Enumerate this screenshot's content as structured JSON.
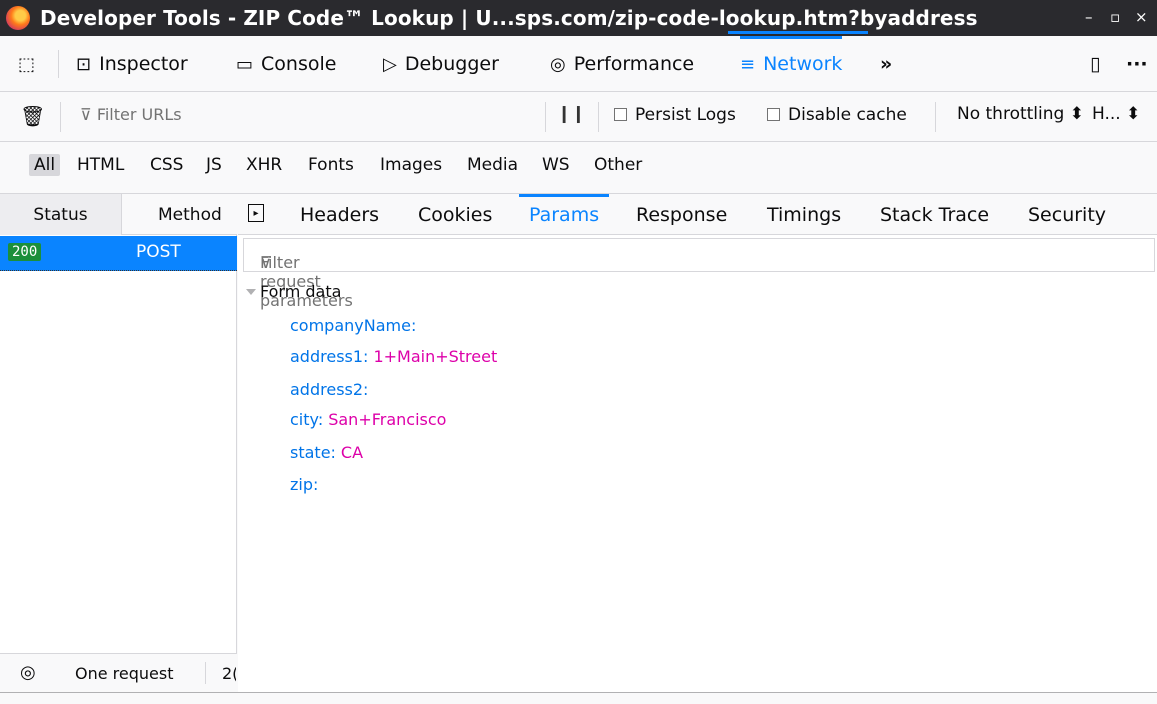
{
  "window": {
    "title": "Developer Tools - ZIP Code™ Lookup | U...sps.com/zip-code-lookup.htm?byaddress",
    "controls": [
      "–",
      "▫",
      "×"
    ]
  },
  "toolbar": {
    "tabs": [
      {
        "label": "Inspector",
        "icon": "inspector-icon"
      },
      {
        "label": "Console",
        "icon": "console-icon"
      },
      {
        "label": "Debugger",
        "icon": "debugger-icon"
      },
      {
        "label": "Performance",
        "icon": "performance-icon"
      },
      {
        "label": "Network",
        "icon": "network-icon",
        "active": true
      }
    ],
    "overflow": "»",
    "more": "···"
  },
  "filterbar": {
    "filter_placeholder": "Filter URLs",
    "pause": "❙❙",
    "persist_logs": "Persist Logs",
    "disable_cache": "Disable cache",
    "throttling": "No throttling ⬍",
    "har": "H... ⬍"
  },
  "type_filters": [
    "All",
    "HTML",
    "CSS",
    "JS",
    "XHR",
    "Fonts",
    "Images",
    "Media",
    "WS",
    "Other"
  ],
  "request_list": {
    "columns": {
      "status": "Status",
      "method": "Method"
    },
    "rows": [
      {
        "status": "200",
        "method": "POST"
      }
    ],
    "footer": {
      "count": "One request",
      "size": "2("
    }
  },
  "details": {
    "tabs": [
      "Headers",
      "Cookies",
      "Params",
      "Response",
      "Timings",
      "Stack Trace",
      "Security"
    ],
    "active_tab": "Params",
    "param_filter_placeholder": "Filter request parameters",
    "section": "Form data",
    "params": [
      {
        "key": "companyName:",
        "value": ""
      },
      {
        "key": "address1:",
        "value": "1+Main+Street"
      },
      {
        "key": "address2:",
        "value": ""
      },
      {
        "key": "city:",
        "value": "San+Francisco"
      },
      {
        "key": "state:",
        "value": "CA"
      },
      {
        "key": "zip:",
        "value": ""
      }
    ]
  },
  "colors": {
    "accent": "#0a84ff",
    "key": "#0074e8",
    "value": "#dd00a9",
    "status_ok": "#1b8f3a"
  }
}
